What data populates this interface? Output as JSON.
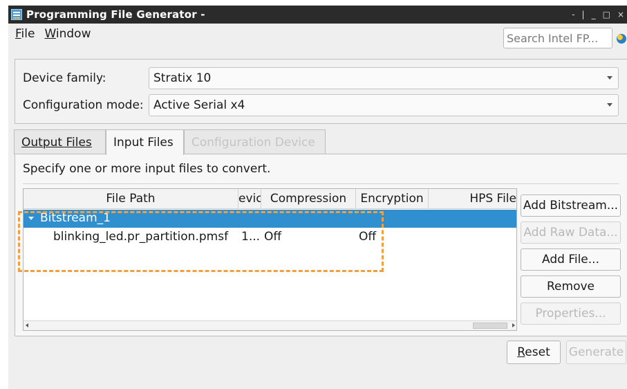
{
  "window": {
    "title": "Programming File Generator -",
    "controls": [
      "-",
      "|",
      "_",
      "□",
      "×"
    ]
  },
  "menu": {
    "items": [
      {
        "label": "File",
        "mnemonic": "F"
      },
      {
        "label": "Window",
        "mnemonic": "W"
      }
    ]
  },
  "search": {
    "value": "Search Intel FP..."
  },
  "device": {
    "family_label": "Device family:",
    "family_value": "Stratix 10",
    "config_label": "Configuration mode:",
    "config_value": "Active Serial x4"
  },
  "tabs": [
    {
      "label": "Output Files",
      "state": "normal"
    },
    {
      "label": "Input Files",
      "state": "active"
    },
    {
      "label": "Configuration Device",
      "state": "disabled"
    }
  ],
  "input_files": {
    "instructions": "Specify one or more input files to convert.",
    "columns": [
      "File Path",
      "evic",
      "Compression",
      "Encryption",
      "HPS File"
    ],
    "rows": [
      {
        "type": "group",
        "label": "Bitstream_1",
        "expanded": true,
        "selected": true
      },
      {
        "type": "file",
        "file_path": "blinking_led.pr_partition.pmsf",
        "device": "1...",
        "compression": "Off",
        "encryption": "Off",
        "hps_file": ""
      }
    ]
  },
  "side_buttons": [
    {
      "label": "Add Bitstream...",
      "enabled": true
    },
    {
      "label": "Add Raw Data...",
      "enabled": false
    },
    {
      "label": "Add File...",
      "enabled": true
    },
    {
      "label": "Remove",
      "enabled": true
    },
    {
      "label": "Properties...",
      "enabled": false
    }
  ],
  "footer": {
    "reset_label": "eset",
    "reset_mnemonic": "R",
    "generate_label": "Generate",
    "generate_enabled": false
  },
  "colors": {
    "titlebar": "#2b2b2b",
    "selection": "#2f8fcf",
    "highlight": "#f0a040"
  }
}
